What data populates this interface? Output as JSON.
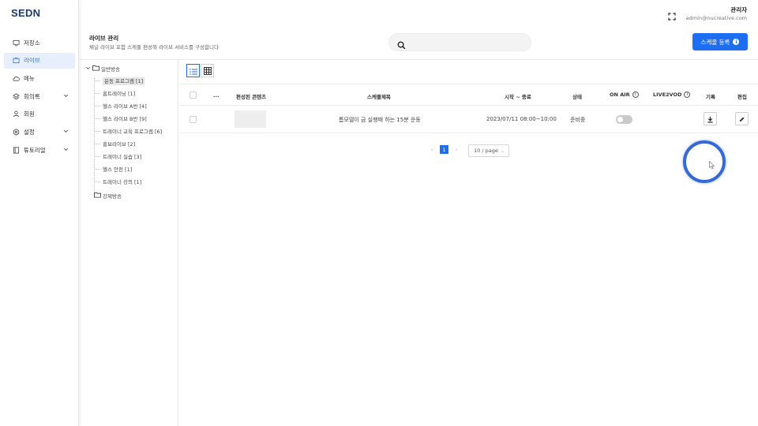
{
  "brand": {
    "logo": "SEDN",
    "accent": "#1e6ef2"
  },
  "header": {
    "user_name": "관리자",
    "user_email": "admin@nucreative.com"
  },
  "sidebar": {
    "items": [
      {
        "label": "저장소",
        "icon": "monitor-icon",
        "active": false,
        "has_chevron": false
      },
      {
        "label": "라이브",
        "icon": "live-tv-icon",
        "active": true,
        "has_chevron": false
      },
      {
        "label": "메뉴",
        "icon": "cloud-icon",
        "active": false,
        "has_chevron": false
      },
      {
        "label": "회의록",
        "icon": "layers-icon",
        "active": false,
        "has_chevron": true
      },
      {
        "label": "회원",
        "icon": "user-icon",
        "active": false,
        "has_chevron": false
      },
      {
        "label": "설정",
        "icon": "gear-icon",
        "active": false,
        "has_chevron": true
      },
      {
        "label": "튜토리얼",
        "icon": "book-icon",
        "active": false,
        "has_chevron": true
      }
    ]
  },
  "page": {
    "title": "라이브 관리",
    "description": "채널 라이브 포함 스케줄 편성해 라이브 서비스를 구성합니다",
    "search_placeholder": "",
    "register_button": "스케줄 등록"
  },
  "tree": {
    "root1": "일반방송",
    "children": [
      "운동 프로그램 [1]",
      "홈트레이닝 [1]",
      "헬스 라이브 A반 [4]",
      "헬스 라이브 B반 [9]",
      "트레이너 교육 프로그램 [6]",
      "홍보라이브 [2]",
      "트레이너 실습 [3]",
      "헬스 안전 [1]",
      "트레이너 강의 [1]"
    ],
    "selected_index": 0,
    "root2": "강제방송"
  },
  "table": {
    "headers": {
      "more": "...",
      "content": "편성된 콘텐츠",
      "title": "스케줄제목",
      "time": "시작 ~ 종료",
      "status": "상태",
      "on_air": "ON AIR",
      "live2vod": "LIVE2VOD",
      "record": "기록",
      "edit": "편집"
    },
    "rows": [
      {
        "title": "틈모델이 금 실행때 하는 15분 운동",
        "time": "2023/07/11 08:00~10:00",
        "status": "준비중",
        "on_air": false
      }
    ]
  },
  "pagination": {
    "current": "1",
    "page_size": "10 / page"
  }
}
